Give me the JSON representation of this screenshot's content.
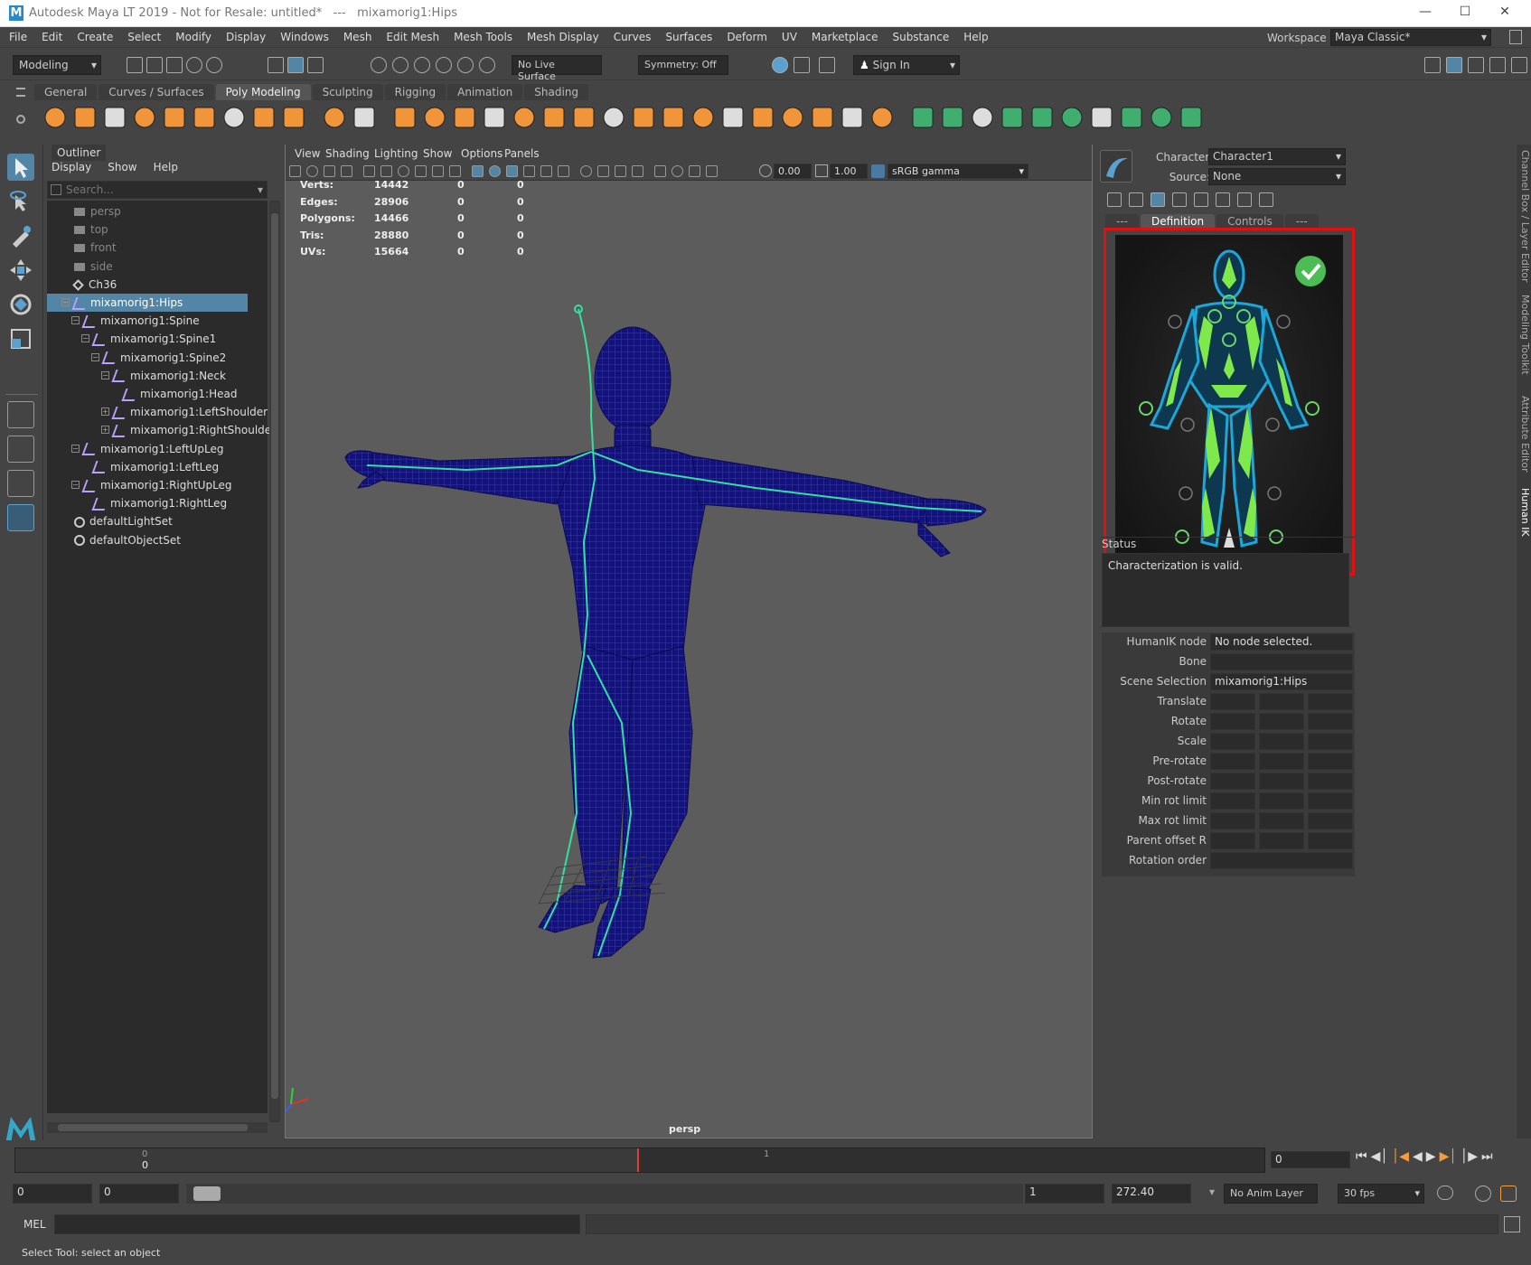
{
  "window": {
    "title": "Autodesk Maya LT 2019 - Not for Resale: untitled*   ---   mixamorig1:Hips",
    "logo": "M"
  },
  "menubar": [
    "File",
    "Edit",
    "Create",
    "Select",
    "Modify",
    "Display",
    "Windows",
    "Mesh",
    "Edit Mesh",
    "Mesh Tools",
    "Mesh Display",
    "Curves",
    "Surfaces",
    "Deform",
    "UV",
    "Marketplace",
    "Substance",
    "Help"
  ],
  "workspace": {
    "label": "Workspace :",
    "value": "Maya Classic*"
  },
  "statusline": {
    "mode": "Modeling",
    "live_surface": "No Live Surface",
    "symmetry": "Symmetry: Off",
    "sign_in": "Sign In"
  },
  "shelf_tabs": [
    "General",
    "Curves / Surfaces",
    "Poly Modeling",
    "Sculpting",
    "Rigging",
    "Animation",
    "Shading"
  ],
  "shelf_active": "Poly Modeling",
  "outliner": {
    "title": "Outliner",
    "menu": [
      "Display",
      "Show",
      "Help"
    ],
    "search_placeholder": "Search...",
    "items": [
      {
        "label": "persp",
        "depth": 0,
        "dim": true
      },
      {
        "label": "top",
        "depth": 0,
        "dim": true
      },
      {
        "label": "front",
        "depth": 0,
        "dim": true
      },
      {
        "label": "side",
        "depth": 0,
        "dim": true
      },
      {
        "label": "Ch36",
        "depth": 0,
        "dim": false
      },
      {
        "label": "mixamorig1:Hips",
        "depth": 0,
        "selected": true
      },
      {
        "label": "mixamorig1:Spine",
        "depth": 1
      },
      {
        "label": "mixamorig1:Spine1",
        "depth": 2
      },
      {
        "label": "mixamorig1:Spine2",
        "depth": 3
      },
      {
        "label": "mixamorig1:Neck",
        "depth": 4
      },
      {
        "label": "mixamorig1:Head",
        "depth": 5
      },
      {
        "label": "mixamorig1:LeftShoulder",
        "depth": 4
      },
      {
        "label": "mixamorig1:RightShoulder",
        "depth": 4
      },
      {
        "label": "mixamorig1:LeftUpLeg",
        "depth": 1
      },
      {
        "label": "mixamorig1:LeftLeg",
        "depth": 2
      },
      {
        "label": "mixamorig1:RightUpLeg",
        "depth": 1
      },
      {
        "label": "mixamorig1:RightLeg",
        "depth": 2
      },
      {
        "label": "defaultLightSet",
        "depth": 0
      },
      {
        "label": "defaultObjectSet",
        "depth": 0
      }
    ]
  },
  "viewport": {
    "menu": [
      "View",
      "Shading",
      "Lighting",
      "Show",
      "Options",
      "Panels"
    ],
    "exposure": "0.00",
    "gamma": "1.00",
    "color_space": "sRGB gamma",
    "camera": "persp",
    "hud": [
      {
        "label": "Verts:",
        "v1": "14442",
        "v2": "0",
        "v3": "0"
      },
      {
        "label": "Edges:",
        "v1": "28906",
        "v2": "0",
        "v3": "0"
      },
      {
        "label": "Polygons:",
        "v1": "14466",
        "v2": "0",
        "v3": "0"
      },
      {
        "label": "Tris:",
        "v1": "28880",
        "v2": "0",
        "v3": "0"
      },
      {
        "label": "UVs:",
        "v1": "15664",
        "v2": "0",
        "v3": "0"
      }
    ]
  },
  "humanik": {
    "character_label": "Character:",
    "character": "Character1",
    "source_label": "Source:",
    "source": "None",
    "tabs": [
      "---",
      "Definition",
      "Controls",
      "---"
    ],
    "active_tab": "Definition",
    "status_label": "Status",
    "status_text": "Characterization is valid.",
    "fields": [
      {
        "label": "HumanIK node",
        "value": "No node selected.",
        "type": "text"
      },
      {
        "label": "Bone",
        "value": "",
        "type": "text"
      },
      {
        "label": "Scene Selection",
        "value": "mixamorig1:Hips",
        "type": "text"
      },
      {
        "label": "Translate",
        "type": "triple"
      },
      {
        "label": "Rotate",
        "type": "triple"
      },
      {
        "label": "Scale",
        "type": "triple"
      },
      {
        "label": "Pre-rotate",
        "type": "triple"
      },
      {
        "label": "Post-rotate",
        "type": "triple"
      },
      {
        "label": "Min rot limit",
        "type": "triple"
      },
      {
        "label": "Max rot limit",
        "type": "triple"
      },
      {
        "label": "Parent offset R",
        "type": "triple"
      },
      {
        "label": "Rotation order",
        "value": "",
        "type": "text"
      }
    ]
  },
  "side_tabs": [
    "Channel Box / Layer Editor",
    "Modeling Toolkit",
    "Attribute Editor",
    "Human IK"
  ],
  "timeline": {
    "start_tick": "0",
    "end_tick": "1",
    "current": "0",
    "frame_field": "0"
  },
  "range": {
    "start": "0",
    "start2": "0",
    "end": "1",
    "end2": "272.40",
    "anim_layer": "No Anim Layer",
    "fps": "30 fps"
  },
  "mel": {
    "label": "MEL"
  },
  "help": "Select Tool: select an object"
}
